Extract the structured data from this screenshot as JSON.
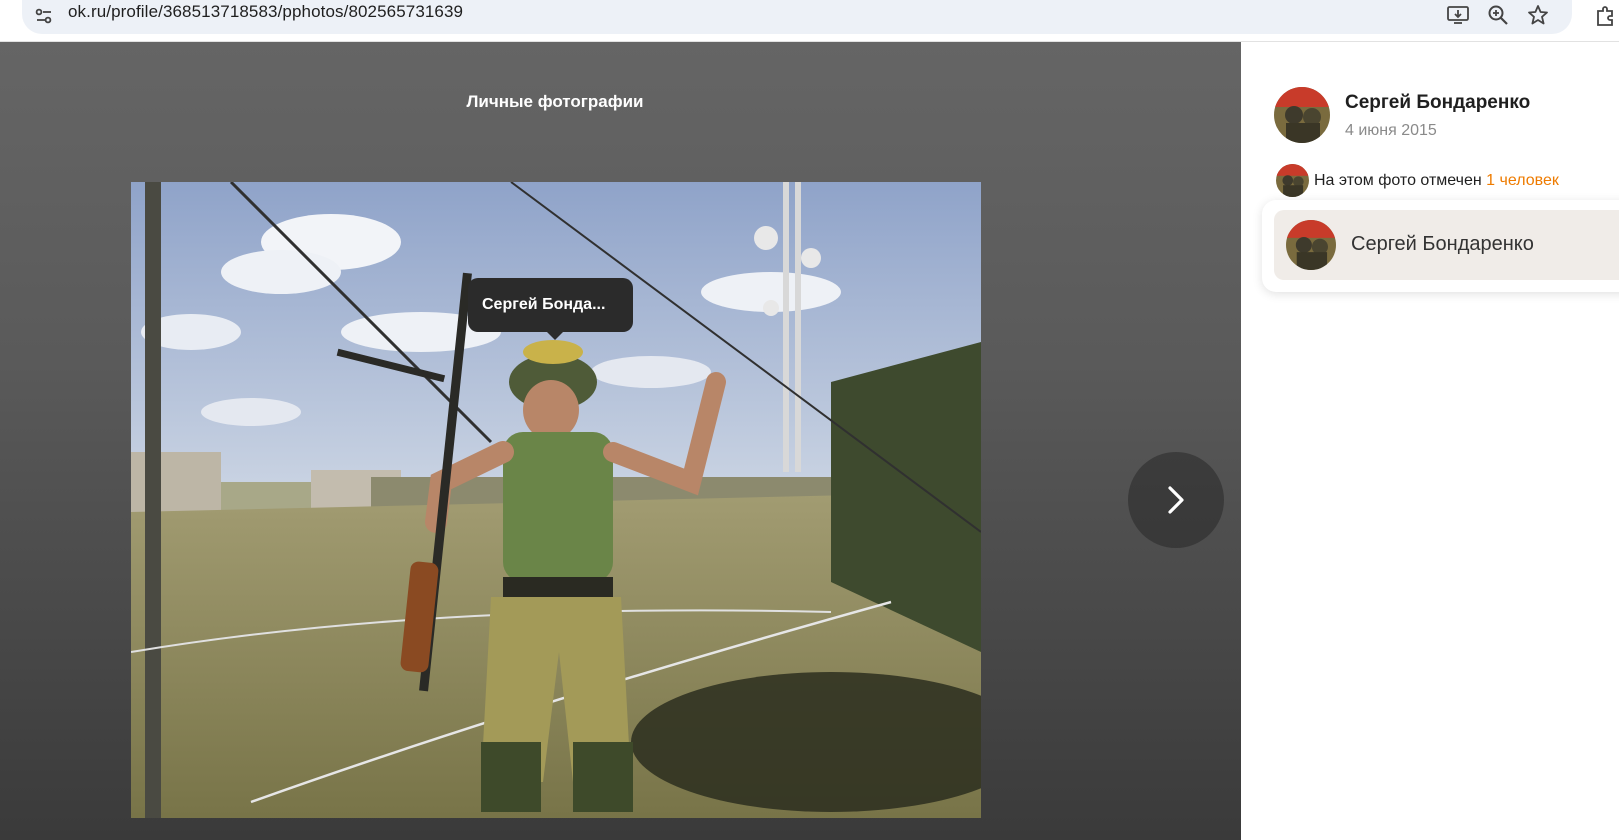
{
  "browser": {
    "url": "ok.ru/profile/368513718583/pphotos/802565731639",
    "icons": [
      "tune-icon",
      "install-app-icon",
      "zoom-icon",
      "bookmark-star-icon",
      "extensions-icon"
    ]
  },
  "viewer": {
    "album_title": "Личные фотографии",
    "tag_label": "Сергей Бонда...",
    "next_icon": "chevron-right-icon"
  },
  "panel": {
    "author_name": "Сергей Бондаренко",
    "date": "4 июня 2015",
    "tagged_prefix": "На этом фото отмечен",
    "tagged_count": "1 человек",
    "tagged_people": [
      {
        "name": "Сергей Бондаренко"
      }
    ]
  },
  "colors": {
    "accent_link": "#ee7b00",
    "viewer_bg": "#5a5a5a",
    "tooltip_bg": "#2b2b2b",
    "popup_item_bg": "#f0ece8"
  }
}
